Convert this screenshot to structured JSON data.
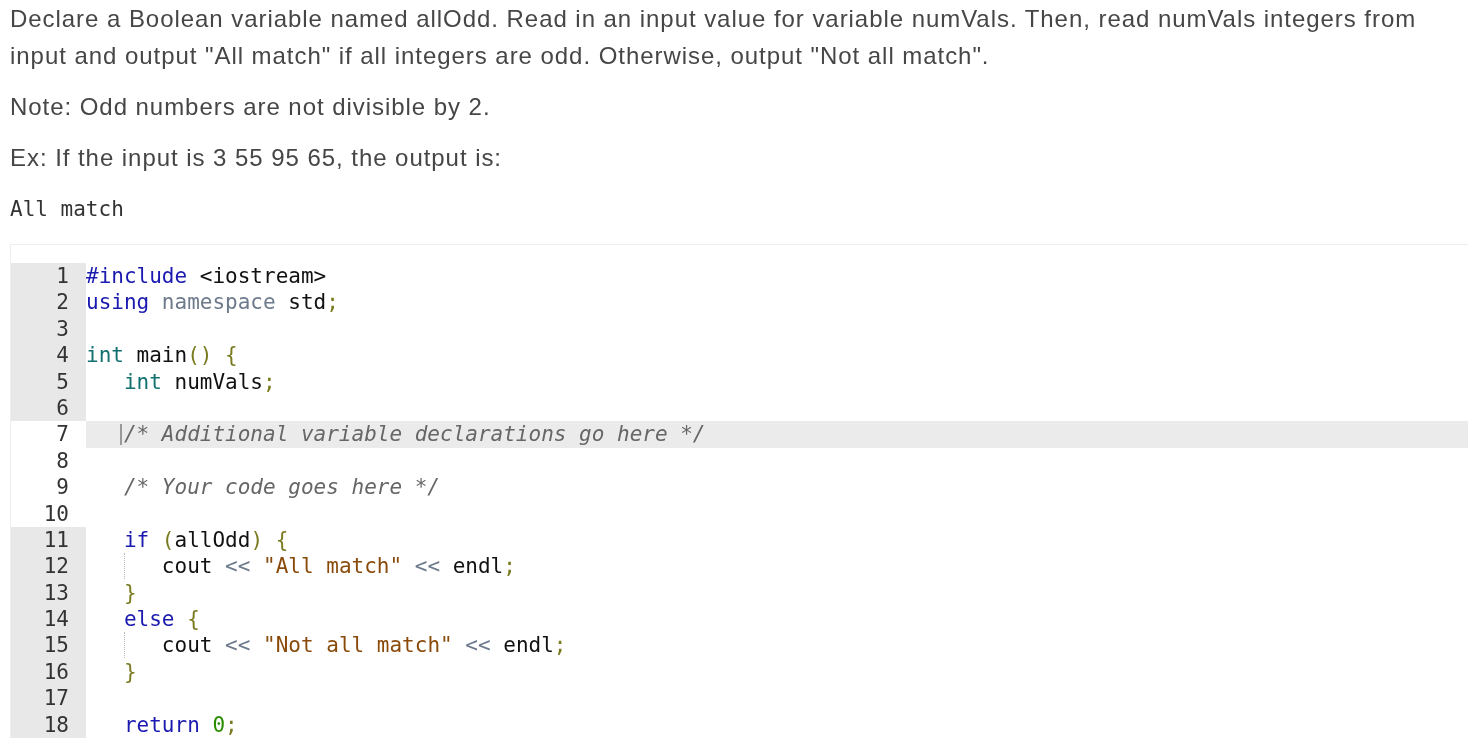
{
  "instructions": [
    {
      "kind": "paragraph",
      "text": "Declare a Boolean variable named allOdd. Read in an input value for variable numVals. Then, read numVals integers from input and output \"All match\" if all integers are odd. Otherwise, output \"Not all match\"."
    },
    {
      "kind": "paragraph",
      "text": "Note: Odd numbers are not divisible by 2."
    },
    {
      "kind": "paragraph",
      "text": "Ex: If the input is 3 55 95 65, the output is:"
    },
    {
      "kind": "output",
      "text": "All match"
    }
  ],
  "editor": {
    "lines": [
      {
        "number": "1",
        "editable": false,
        "active": false,
        "tokens": [
          {
            "kind": "keyword",
            "text": "#include"
          },
          {
            "kind": "plain",
            "text": " <iostream>"
          }
        ]
      },
      {
        "number": "2",
        "editable": false,
        "active": false,
        "tokens": [
          {
            "kind": "keyword",
            "text": "using"
          },
          {
            "kind": "namespace",
            "text": " namespace"
          },
          {
            "kind": "plain",
            "text": " std"
          },
          {
            "kind": "punct",
            "text": ";"
          }
        ]
      },
      {
        "number": "3",
        "editable": false,
        "active": false
      },
      {
        "number": "4",
        "editable": false,
        "active": false,
        "tokens": [
          {
            "kind": "type",
            "text": "int"
          },
          {
            "kind": "plain",
            "text": " main"
          },
          {
            "kind": "punct",
            "text": "() {"
          }
        ]
      },
      {
        "number": "5",
        "editable": false,
        "active": false,
        "tokens": [
          {
            "kind": "type",
            "text": "   int"
          },
          {
            "kind": "plain",
            "text": " numVals"
          },
          {
            "kind": "punct",
            "text": ";"
          }
        ]
      },
      {
        "number": "6",
        "editable": false,
        "active": false
      },
      {
        "number": "7",
        "editable": true,
        "active": true,
        "caret": true,
        "tokens": [
          {
            "kind": "comment",
            "text": "   /* Additional variable declarations go here */"
          }
        ]
      },
      {
        "number": "8",
        "editable": true,
        "active": false
      },
      {
        "number": "9",
        "editable": true,
        "active": false,
        "tokens": [
          {
            "kind": "comment",
            "text": "   /* Your code goes here */"
          }
        ]
      },
      {
        "number": "10",
        "editable": true,
        "active": false
      },
      {
        "number": "11",
        "editable": false,
        "active": false,
        "tokens": [
          {
            "kind": "keyword",
            "text": "   if"
          },
          {
            "kind": "punct",
            "text": " ("
          },
          {
            "kind": "plain",
            "text": "allOdd"
          },
          {
            "kind": "punct",
            "text": ") {"
          }
        ]
      },
      {
        "number": "12",
        "editable": false,
        "active": false,
        "guide": true,
        "tokens": [
          {
            "kind": "plain",
            "text": "      cout"
          },
          {
            "kind": "operator",
            "text": " <<"
          },
          {
            "kind": "string",
            "text": " \"All match\""
          },
          {
            "kind": "operator",
            "text": " <<"
          },
          {
            "kind": "plain",
            "text": " endl"
          },
          {
            "kind": "punct",
            "text": ";"
          }
        ]
      },
      {
        "number": "13",
        "editable": false,
        "active": false,
        "tokens": [
          {
            "kind": "punct",
            "text": "   }"
          }
        ]
      },
      {
        "number": "14",
        "editable": false,
        "active": false,
        "tokens": [
          {
            "kind": "keyword",
            "text": "   else"
          },
          {
            "kind": "punct",
            "text": " {"
          }
        ]
      },
      {
        "number": "15",
        "editable": false,
        "active": false,
        "guide": true,
        "tokens": [
          {
            "kind": "plain",
            "text": "      cout"
          },
          {
            "kind": "operator",
            "text": " <<"
          },
          {
            "kind": "string",
            "text": " \"Not all match\""
          },
          {
            "kind": "operator",
            "text": " <<"
          },
          {
            "kind": "plain",
            "text": " endl"
          },
          {
            "kind": "punct",
            "text": ";"
          }
        ]
      },
      {
        "number": "16",
        "editable": false,
        "active": false,
        "tokens": [
          {
            "kind": "punct",
            "text": "   }"
          }
        ]
      },
      {
        "number": "17",
        "editable": false,
        "active": false
      },
      {
        "number": "18",
        "editable": false,
        "active": false,
        "tokens": [
          {
            "kind": "keyword",
            "text": "   return"
          },
          {
            "kind": "number",
            "text": " 0"
          },
          {
            "kind": "punct",
            "text": ";"
          }
        ]
      }
    ]
  }
}
